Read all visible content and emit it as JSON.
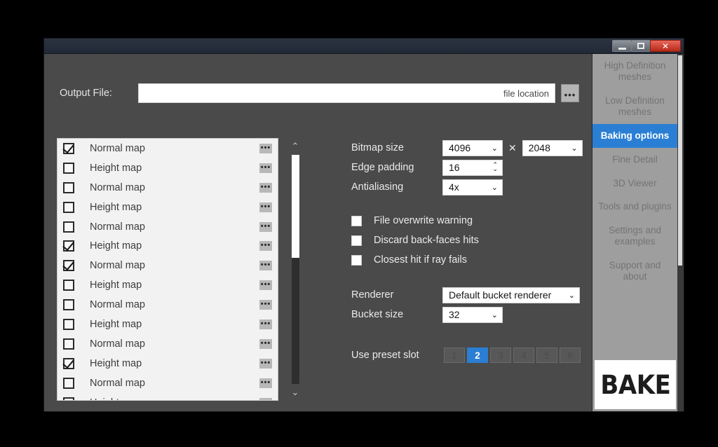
{
  "window": {
    "title": "",
    "controls": [
      {
        "name": "minimize",
        "glyph": ""
      },
      {
        "name": "maximize",
        "glyph": ""
      },
      {
        "name": "close",
        "glyph": "✕"
      }
    ]
  },
  "output": {
    "label": "Output File:",
    "value": "",
    "placeholder": "file location",
    "browse_icon": "•••"
  },
  "map_list": {
    "rows": [
      {
        "label": "Normal map",
        "checked": true,
        "menu_icon": "•••"
      },
      {
        "label": "Height map",
        "checked": false,
        "menu_icon": "•••"
      },
      {
        "label": "Normal map",
        "checked": false,
        "menu_icon": "•••"
      },
      {
        "label": "Height map",
        "checked": false,
        "menu_icon": "•••"
      },
      {
        "label": "Normal map",
        "checked": false,
        "menu_icon": "•••"
      },
      {
        "label": "Height map",
        "checked": true,
        "menu_icon": "•••"
      },
      {
        "label": "Normal map",
        "checked": true,
        "menu_icon": "•••"
      },
      {
        "label": "Height map",
        "checked": false,
        "menu_icon": "•••"
      },
      {
        "label": "Normal map",
        "checked": false,
        "menu_icon": "•••"
      },
      {
        "label": "Height map",
        "checked": false,
        "menu_icon": "•••"
      },
      {
        "label": "Normal map",
        "checked": false,
        "menu_icon": "•••"
      },
      {
        "label": "Height map",
        "checked": true,
        "menu_icon": "•••"
      },
      {
        "label": "Normal map",
        "checked": false,
        "menu_icon": "•••"
      },
      {
        "label": "Height map",
        "checked": false,
        "menu_icon": "•••"
      }
    ],
    "scrollbar": {
      "up_icon": "⌃",
      "down_icon": "⌄",
      "thumb_position_percent": 0,
      "thumb_size_percent": 45
    }
  },
  "settings": {
    "bitmap_size": {
      "label": "Bitmap size",
      "width_value": "4096",
      "separator": "✕",
      "height_value": "2048",
      "chevron": "⌄"
    },
    "edge_padding": {
      "label": "Edge padding",
      "value": "16",
      "up_icon": "⌃",
      "down_icon": "⌄"
    },
    "antialiasing": {
      "label": "Antialiasing",
      "value": "4x",
      "chevron": "⌄"
    },
    "options": [
      {
        "label": "File overwrite warning",
        "checked": false
      },
      {
        "label": "Discard back-faces hits",
        "checked": false
      },
      {
        "label": "Closest hit if ray fails",
        "checked": false
      }
    ],
    "renderer": {
      "label": "Renderer",
      "value": "Default bucket renderer",
      "chevron": "⌄"
    },
    "bucket_size": {
      "label": "Bucket size",
      "value": "32",
      "chevron": "⌄"
    },
    "preset": {
      "label": "Use preset slot",
      "slots": [
        "1",
        "2",
        "3",
        "4",
        "5",
        "6"
      ],
      "active_index": 1
    }
  },
  "sidebar": {
    "items": [
      {
        "label": "High Definition meshes",
        "active": false
      },
      {
        "label": "Low Definition meshes",
        "active": false
      },
      {
        "label": "Baking options",
        "active": true
      },
      {
        "label": "Fine Detail",
        "active": false
      },
      {
        "label": "3D Viewer",
        "active": false
      },
      {
        "label": "Tools and plugins",
        "active": false
      },
      {
        "label": "Settings and examples",
        "active": false
      },
      {
        "label": "Support and about",
        "active": false
      }
    ],
    "bake_button_label": "BAKE"
  },
  "colors": {
    "accent_blue": "#2a7fd4",
    "window_bg": "#4a4a4a",
    "titlebar": "#262d3a",
    "sidebar_bg": "#9e9e9e",
    "list_bg": "#f2f2f2",
    "close_red": "#c4301c"
  }
}
